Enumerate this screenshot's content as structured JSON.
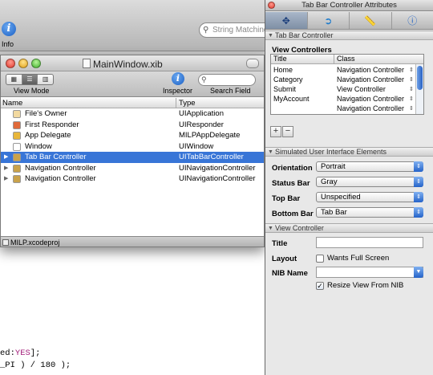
{
  "background": {
    "info_label": "Info",
    "search_placeholder": "String Matching",
    "code_lines": [
      "ed:YES];",
      "_PI ) / 180 );"
    ],
    "code_keyword": "YES"
  },
  "xib": {
    "title": "MainWindow.xib",
    "view_mode_label": "View Mode",
    "inspector_label": "Inspector",
    "search_field_label": "Search Field",
    "columns": {
      "name": "Name",
      "type": "Type"
    },
    "rows": [
      {
        "name": "File's Owner",
        "type": "UIApplication",
        "icon": "cube-icon",
        "icon_color": "#f2d9a0",
        "disclosure": "",
        "selected": false
      },
      {
        "name": "First Responder",
        "type": "UIResponder",
        "icon": "cube-icon",
        "icon_color": "#e06a3a",
        "disclosure": "",
        "selected": false
      },
      {
        "name": "App Delegate",
        "type": "MILPAppDelegate",
        "icon": "cube-icon",
        "icon_color": "#e8b63a",
        "disclosure": "",
        "selected": false
      },
      {
        "name": "Window",
        "type": "UIWindow",
        "icon": "window-icon",
        "icon_color": "#ffffff",
        "disclosure": "",
        "selected": false
      },
      {
        "name": "Tab Bar Controller",
        "type": "UITabBarController",
        "icon": "tab-bar-controller-icon",
        "icon_color": "#c9a24a",
        "disclosure": "▶",
        "selected": true
      },
      {
        "name": "Navigation Controller",
        "type": "UINavigationController",
        "icon": "navigation-controller-icon",
        "icon_color": "#c9a24a",
        "disclosure": "▶",
        "selected": false
      },
      {
        "name": "Navigation Controller",
        "type": "UINavigationController",
        "icon": "navigation-controller-icon",
        "icon_color": "#c9a24a",
        "disclosure": "▶",
        "selected": false
      }
    ],
    "status_project": "MILP.xcodeproj"
  },
  "inspector": {
    "title": "Tab Bar Controller Attributes",
    "tabs": [
      "attributes-icon",
      "connections-icon",
      "size-icon",
      "identity-icon"
    ],
    "section_tab_bar": "Tab Bar Controller",
    "view_controllers_label": "View Controllers",
    "vc_columns": {
      "title": "Title",
      "class": "Class"
    },
    "view_controllers": [
      {
        "title": "Home",
        "class": "Navigation Controller"
      },
      {
        "title": "Category",
        "class": "Navigation Controller"
      },
      {
        "title": "Submit",
        "class": "View Controller"
      },
      {
        "title": "MyAccount",
        "class": "Navigation Controller"
      },
      {
        "title": "",
        "class": "Navigation Controller"
      }
    ],
    "add_label": "+",
    "remove_label": "−",
    "section_simulated": "Simulated User Interface Elements",
    "orientation_label": "Orientation",
    "orientation_value": "Portrait",
    "status_bar_label": "Status Bar",
    "status_bar_value": "Gray",
    "top_bar_label": "Top Bar",
    "top_bar_value": "Unspecified",
    "bottom_bar_label": "Bottom Bar",
    "bottom_bar_value": "Tab Bar",
    "section_view_controller": "View Controller",
    "title_label": "Title",
    "title_value": "",
    "layout_label": "Layout",
    "wants_full_screen_label": "Wants Full Screen",
    "wants_full_screen_checked": false,
    "nib_name_label": "NIB Name",
    "nib_name_value": "",
    "resize_view_label": "Resize View From NIB",
    "resize_view_checked": true
  },
  "colors": {
    "selection": "#3875d7",
    "accent_blue": "#2463c9"
  }
}
